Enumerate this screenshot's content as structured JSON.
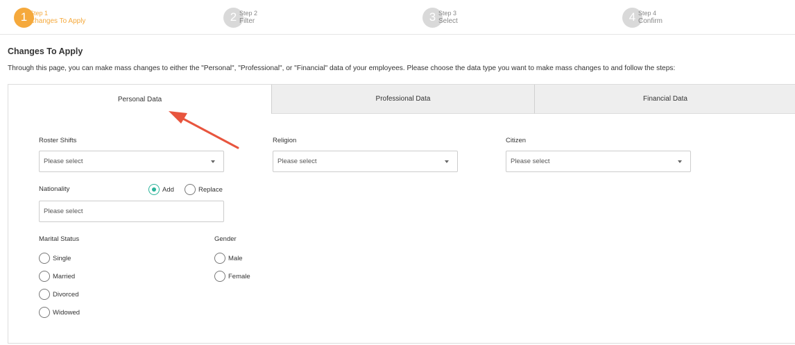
{
  "stepper": {
    "steps": [
      {
        "number": "1",
        "step": "Step 1",
        "label": "Changes To Apply"
      },
      {
        "number": "2",
        "step": "Step 2",
        "label": "Filter"
      },
      {
        "number": "3",
        "step": "Step 3",
        "label": "Select"
      },
      {
        "number": "4",
        "step": "Step 4",
        "label": "Confirm"
      }
    ],
    "active_index": 0
  },
  "page": {
    "title": "Changes To Apply",
    "description": "Through this page, you can make mass changes to either the \"Personal\", \"Professional\", or \"Financial\" data of your employees. Please choose the data type you want to make mass changes to and follow the steps:"
  },
  "tabs": [
    {
      "label": "Personal Data",
      "active": true
    },
    {
      "label": "Professional Data",
      "active": false
    },
    {
      "label": "Financial Data",
      "active": false
    }
  ],
  "form": {
    "roster_shifts": {
      "label": "Roster Shifts",
      "value": "Please select"
    },
    "religion": {
      "label": "Religion",
      "value": "Please select"
    },
    "citizen": {
      "label": "Citizen",
      "value": "Please select"
    },
    "nationality": {
      "label": "Nationality",
      "placeholder": "Please select",
      "mode_options": [
        {
          "label": "Add",
          "checked": true
        },
        {
          "label": "Replace",
          "checked": false
        }
      ]
    },
    "marital_status": {
      "label": "Marital Status",
      "options": [
        "Single",
        "Married",
        "Divorced",
        "Widowed"
      ]
    },
    "gender": {
      "label": "Gender",
      "options": [
        "Male",
        "Female"
      ]
    }
  },
  "colors": {
    "active_step": "#f5a93c",
    "inactive_step": "#d9d9d9",
    "radio_checked": "#2bb39a",
    "annotation_arrow": "#e8553e"
  },
  "icons": {
    "select_caret": "caret-down-icon",
    "annotation": "arrow-icon"
  }
}
